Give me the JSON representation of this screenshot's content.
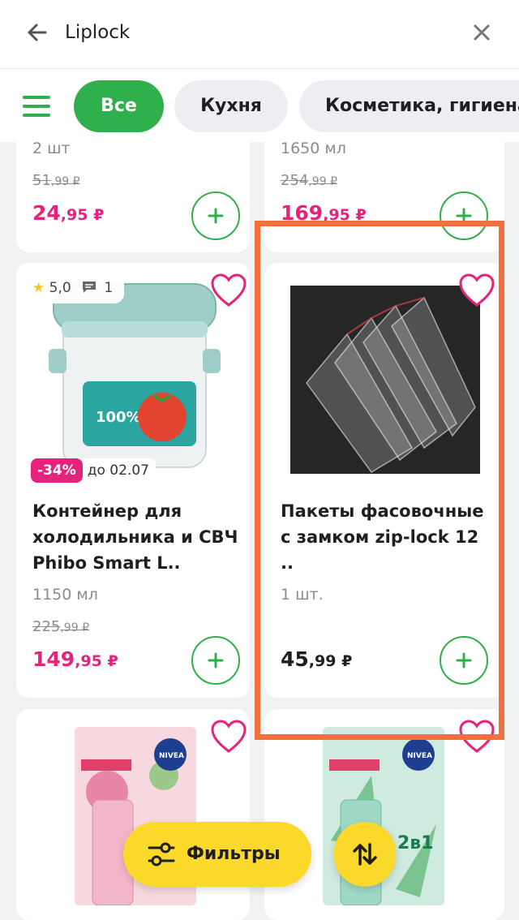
{
  "search": {
    "query": "Liplock"
  },
  "categories": [
    {
      "label": "Все",
      "active": true
    },
    {
      "label": "Кухня"
    },
    {
      "label": "Косметика, гигиена"
    }
  ],
  "top_row": [
    {
      "unit": "2 шт",
      "old_rub": "51",
      "old_kop": ",99 ₽",
      "price_rub": "24",
      "price_kop": ",95 ₽"
    },
    {
      "unit": "1650 мл",
      "old_rub": "254",
      "old_kop": ",99 ₽",
      "price_rub": "169",
      "price_kop": ",95 ₽"
    }
  ],
  "products": [
    {
      "name": "Контейнер для холодильника и СВЧ Phibo Smart L..",
      "rating": "5,0",
      "reviews": "1",
      "discount": "-34%",
      "discount_until": "до 02.07",
      "unit": "1150 мл",
      "old_rub": "225",
      "old_kop": ",99 ₽",
      "price_rub": "149",
      "price_kop": ",95 ₽"
    },
    {
      "name": "Пакеты фасовочные с замком zip-lock 12 ..",
      "unit": "1 шт.",
      "price_rub": "45",
      "price_kop": ",99 ₽"
    }
  ],
  "bottom": {
    "filters_label": "Фильтры"
  },
  "colors": {
    "accent_green": "#2fb04c",
    "price_pink": "#e6237c",
    "fab_yellow": "#fbd92a",
    "highlight_orange": "#f2703e"
  },
  "icons": [
    "back-arrow-icon",
    "close-icon",
    "menu-icon",
    "heart-icon",
    "plus-icon",
    "star-icon",
    "comment-icon",
    "filters-icon",
    "sort-icon"
  ]
}
